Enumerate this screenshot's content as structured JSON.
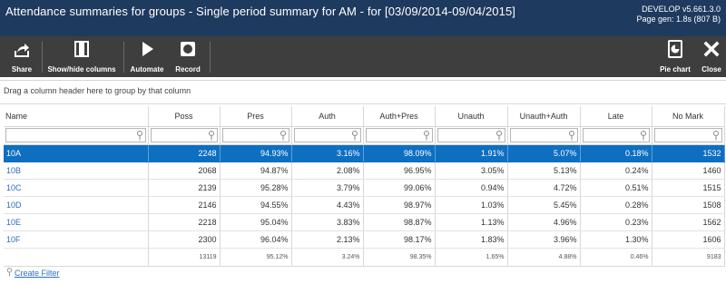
{
  "titlebar": {
    "title": "Attendance summaries for groups - Single period summary for AM - for [03/09/2014-09/04/2015]",
    "version": "DEVELOP v5.661.3.0",
    "page_gen": "Page gen: 1.8s (807 B)"
  },
  "toolbar": {
    "share": "Share",
    "show_hide_columns": "Show/hide columns",
    "automate": "Automate",
    "record": "Record",
    "pie_chart": "Pie chart",
    "close": "Close"
  },
  "grid": {
    "group_hint": "Drag a column header here to group by that column",
    "columns": [
      "Name",
      "Poss",
      "Pres",
      "Auth",
      "Auth+Pres",
      "Unauth",
      "Unauth+Auth",
      "Late",
      "No Mark"
    ],
    "rows": [
      [
        "10A",
        "2248",
        "94.93%",
        "3.16%",
        "98.09%",
        "1.91%",
        "5.07%",
        "0.18%",
        "1532"
      ],
      [
        "10B",
        "2068",
        "94.87%",
        "2.08%",
        "96.95%",
        "3.05%",
        "5.13%",
        "0.24%",
        "1460"
      ],
      [
        "10C",
        "2139",
        "95.28%",
        "3.79%",
        "99.06%",
        "0.94%",
        "4.72%",
        "0.51%",
        "1515"
      ],
      [
        "10D",
        "2146",
        "94.55%",
        "4.43%",
        "98.97%",
        "1.03%",
        "5.45%",
        "0.28%",
        "1508"
      ],
      [
        "10E",
        "2218",
        "95.04%",
        "3.83%",
        "98.87%",
        "1.13%",
        "4.96%",
        "0.23%",
        "1562"
      ],
      [
        "10F",
        "2300",
        "96.04%",
        "2.13%",
        "98.17%",
        "1.83%",
        "3.96%",
        "1.30%",
        "1606"
      ]
    ],
    "selected_row": 0,
    "totals": [
      "",
      "13119",
      "95.12%",
      "3.24%",
      "98.35%",
      "1.65%",
      "4.88%",
      "0.46%",
      "9183"
    ]
  },
  "footer": {
    "create_filter": "Create Filter"
  },
  "colors": {
    "titlebar": "#1f3a5f",
    "toolbar": "#3e3e3e",
    "selection": "#0e6fc1",
    "link": "#2a6ebf"
  },
  "icons": [
    "share-icon",
    "columns-icon",
    "play-icon",
    "record-icon",
    "pie-chart-icon",
    "close-icon",
    "filter-icon"
  ]
}
